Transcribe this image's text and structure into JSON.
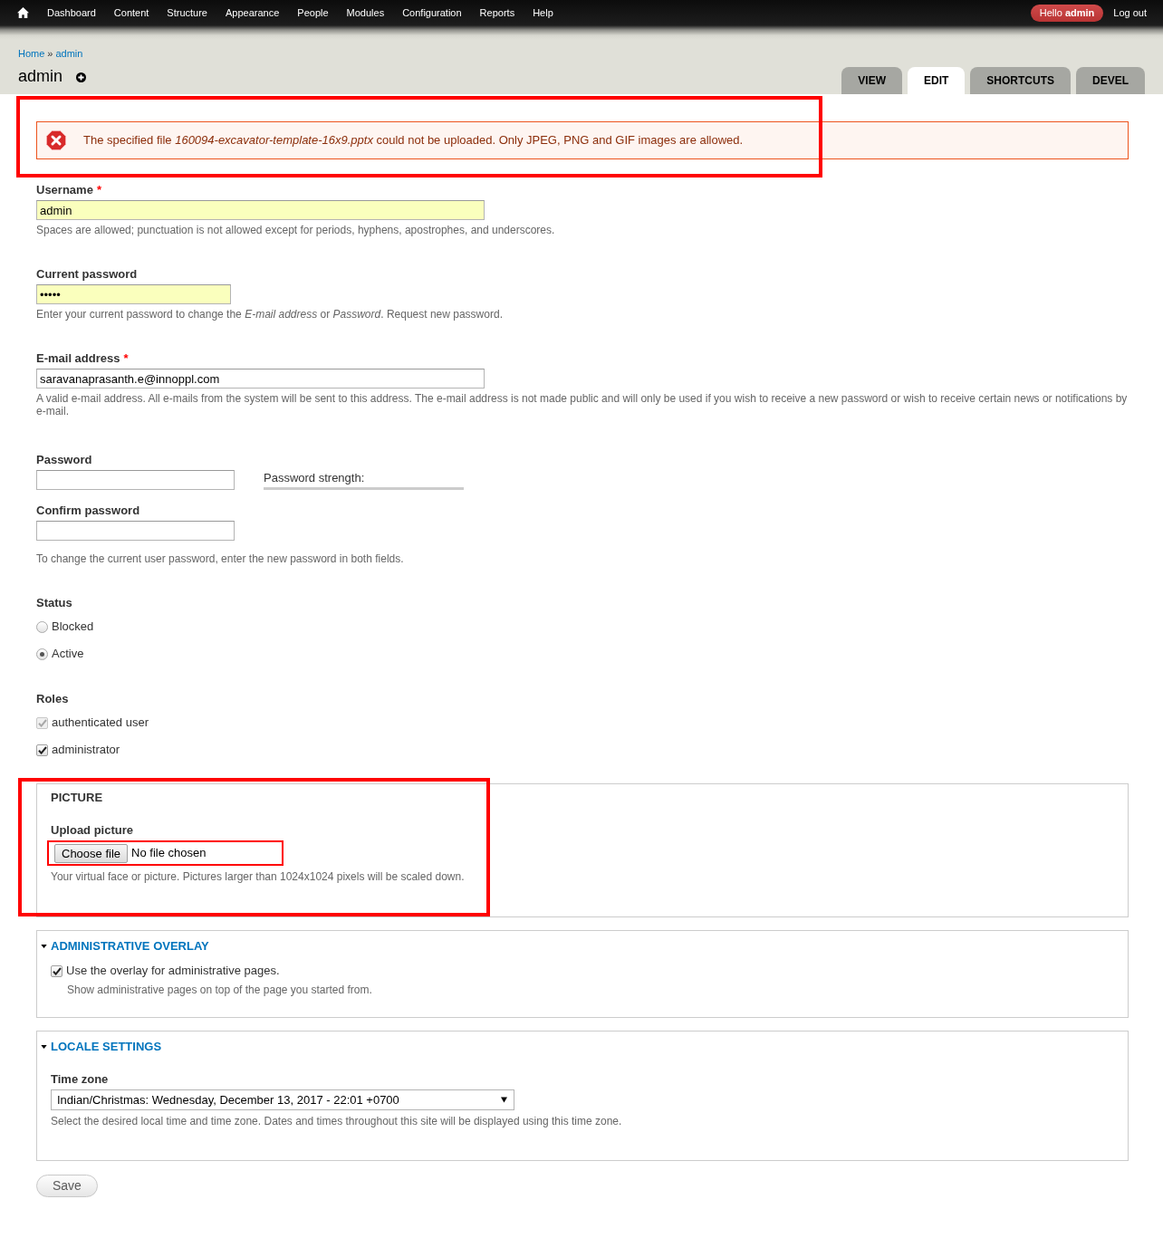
{
  "toolbar": {
    "menu": [
      {
        "label": "Dashboard"
      },
      {
        "label": "Content"
      },
      {
        "label": "Structure"
      },
      {
        "label": "Appearance"
      },
      {
        "label": "People"
      },
      {
        "label": "Modules"
      },
      {
        "label": "Configuration"
      },
      {
        "label": "Reports"
      },
      {
        "label": "Help"
      }
    ],
    "greeting": "Hello **admin**",
    "logout": "Log out"
  },
  "header": {
    "breadcrumb": {
      "items": [
        "Home",
        "admin"
      ],
      "separator": "»"
    },
    "title": "admin",
    "tabs": [
      {
        "label": "VIEW",
        "selected": false
      },
      {
        "label": "EDIT",
        "selected": true
      },
      {
        "label": "SHORTCUTS",
        "selected": false
      },
      {
        "label": "DEVEL",
        "selected": false
      }
    ]
  },
  "messages": [
    {
      "kind": "error",
      "text": "The specified file *160094-excavator-template-16x9.pptx* could not be uploaded. Only JPEG, PNG and GIF images are allowed.",
      "highlighted": true
    }
  ],
  "account_fields": [
    {
      "kind": "text",
      "label": "Username",
      "required_mark": "*",
      "value": "admin",
      "autofilled": true,
      "description": "Spaces are allowed; punctuation is not allowed except for periods, hyphens, apostrophes, and underscores."
    },
    {
      "kind": "password",
      "label": "Current password",
      "value": "•••••",
      "autofilled": true,
      "description": "Enter your current password to change the *E-mail address* or *Password*.",
      "description_link": "Request new password",
      "description_tail": "."
    },
    {
      "kind": "email",
      "label": "E-mail address",
      "required_mark": "*",
      "value": "saravanaprasanth.e@innoppl.com",
      "autofilled": false,
      "description": "A valid e-mail address. All e-mails from the system will be sent to this address. The e-mail address is not made public and will only be used if you wish to receive a new password or wish to receive certain news or notifications by e-mail."
    },
    {
      "kind": "new_password",
      "password_label": "Password",
      "strength_label": "Password strength:",
      "level": 0,
      "confirm_label": "Confirm password",
      "description": "To change the current user password, enter the new password in both fields."
    },
    {
      "kind": "radios",
      "label": "Status",
      "options": [
        {
          "label": "Blocked",
          "selected": false
        },
        {
          "label": "Active",
          "selected": true
        }
      ]
    },
    {
      "kind": "checkboxes",
      "label": "Roles",
      "options": [
        {
          "label": "authenticated user",
          "checked": true,
          "disabled": true
        },
        {
          "label": "administrator",
          "checked": true,
          "disabled": false
        }
      ]
    }
  ],
  "fieldsets": [
    {
      "kind": "plain",
      "legend": "PICTURE",
      "highlighted": true,
      "items": [
        {
          "kind": "file",
          "label": "Upload picture",
          "button": "Choose file",
          "status": "No file chosen",
          "highlighted": true,
          "description": "Your virtual face or picture. Pictures larger than 1024x1024 pixels will be scaled down."
        }
      ]
    },
    {
      "kind": "collapsible",
      "legend": "ADMINISTRATIVE OVERLAY",
      "expanded": true,
      "items": [
        {
          "kind": "checkbox",
          "label": "Use the overlay for administrative pages.",
          "checked": true,
          "description": "Show administrative pages on top of the page you started from."
        }
      ]
    },
    {
      "kind": "collapsible",
      "legend": "LOCALE SETTINGS",
      "expanded": true,
      "items": [
        {
          "kind": "select",
          "label": "Time zone",
          "value": "Indian/Christmas: Wednesday, December 13, 2017 - 22:01 +0700",
          "description": "Select the desired local time and time zone. Dates and times throughout this site will be displayed using this time zone."
        }
      ]
    }
  ],
  "save_button": "Save"
}
